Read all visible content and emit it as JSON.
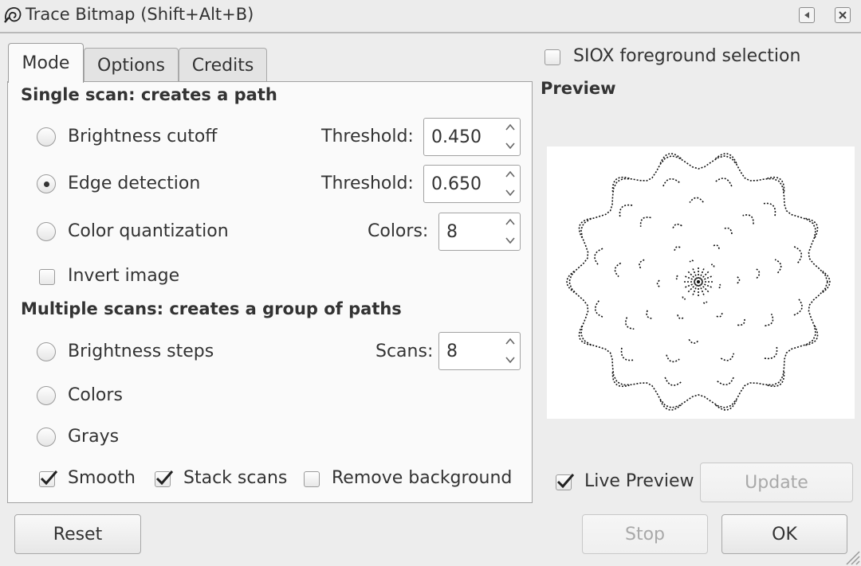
{
  "window": {
    "title": "Trace Bitmap (Shift+Alt+B)"
  },
  "tabs": [
    {
      "label": "Mode",
      "active": true
    },
    {
      "label": "Options",
      "active": false
    },
    {
      "label": "Credits",
      "active": false
    }
  ],
  "single_scan": {
    "heading": "Single scan: creates a path",
    "options": [
      {
        "label": "Brightness cutoff",
        "selected": false,
        "param_label": "Threshold:",
        "value": "0.450"
      },
      {
        "label": "Edge detection",
        "selected": true,
        "param_label": "Threshold:",
        "value": "0.650"
      },
      {
        "label": "Color quantization",
        "selected": false,
        "param_label": "Colors:",
        "value": "8"
      }
    ],
    "invert_image": {
      "label": "Invert image",
      "checked": false
    }
  },
  "multiple_scans": {
    "heading": "Multiple scans: creates a group of paths",
    "brightness_steps": {
      "label": "Brightness steps",
      "selected": false,
      "param_label": "Scans:",
      "value": "8"
    },
    "colors": {
      "label": "Colors",
      "selected": false
    },
    "grays": {
      "label": "Grays",
      "selected": false
    },
    "smooth": {
      "label": "Smooth",
      "checked": true
    },
    "stack_scans": {
      "label": "Stack scans",
      "checked": true
    },
    "remove_background": {
      "label": "Remove background",
      "checked": false
    }
  },
  "siox": {
    "label": "SIOX foreground selection",
    "checked": false
  },
  "preview": {
    "heading": "Preview",
    "live_preview": {
      "label": "Live Preview",
      "checked": true
    },
    "update_label": "Update"
  },
  "buttons": {
    "reset": "Reset",
    "stop": "Stop",
    "ok": "OK"
  },
  "icons": {
    "app": "trace-bitmap-icon",
    "titlebar": [
      "restore-icon",
      "close-icon"
    ],
    "spin": [
      "arrow-up-icon",
      "arrow-down-icon"
    ],
    "resize": "resize-grip-icon"
  }
}
